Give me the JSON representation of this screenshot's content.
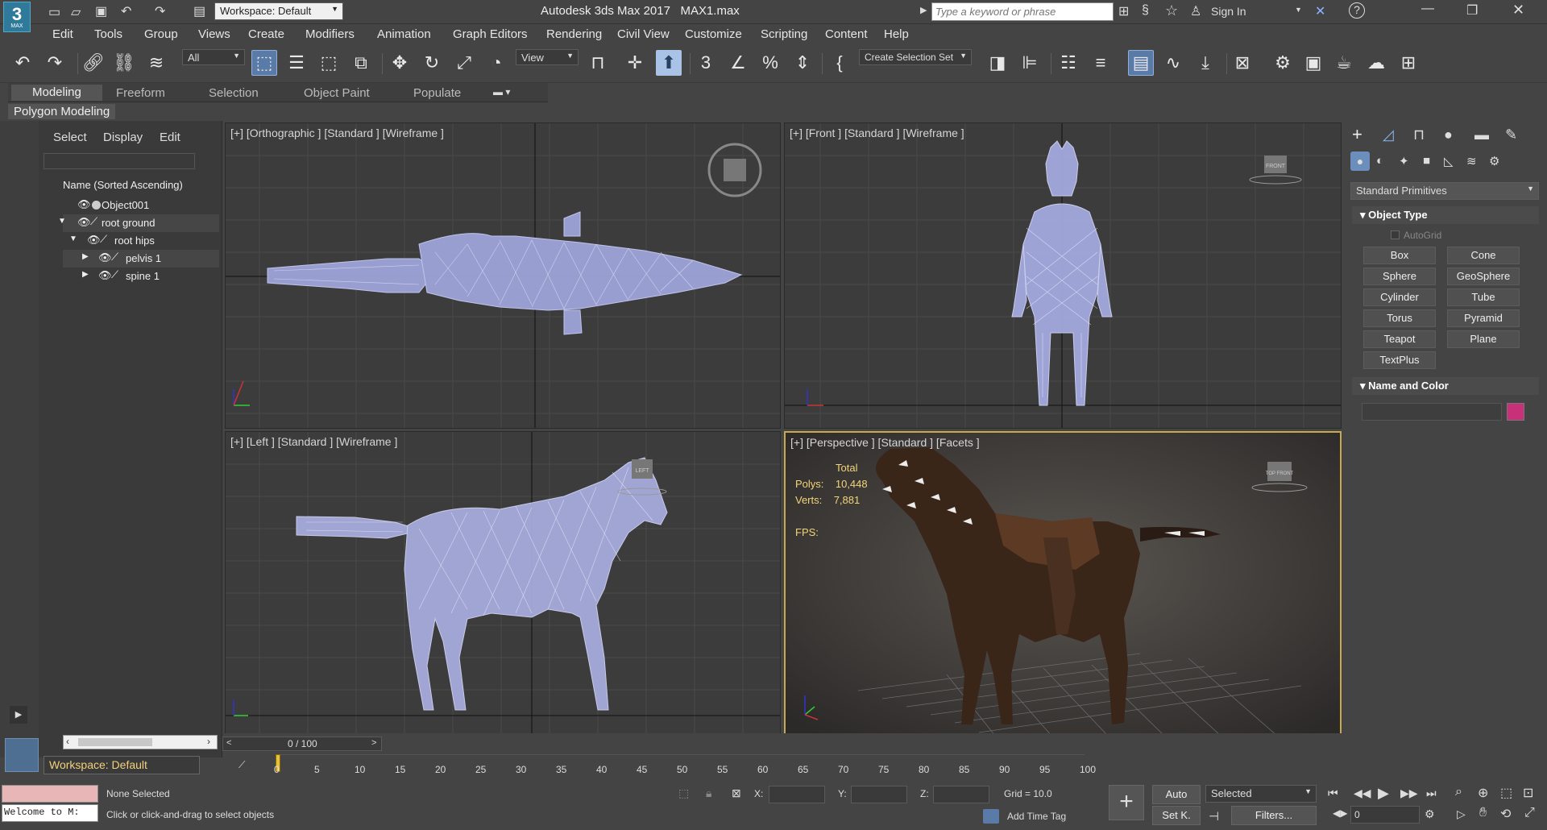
{
  "titlebar": {
    "workspace_label": "Workspace: Default",
    "title": "Autodesk 3ds Max 2017",
    "file": "MAX1.max",
    "search_placeholder": "Type a keyword or phrase",
    "sign_in": "Sign In",
    "logo_text": "MAX"
  },
  "menu": [
    "Edit",
    "Tools",
    "Group",
    "Views",
    "Create",
    "Modifiers",
    "Animation",
    "Graph Editors",
    "Rendering",
    "Civil View",
    "Customize",
    "Scripting",
    "Content",
    "Help"
  ],
  "toolbar": {
    "filter_value": "All",
    "refcoord_value": "View",
    "selection_set": "Create Selection Set"
  },
  "ribbon": {
    "tabs": [
      "Modeling",
      "Freeform",
      "Selection",
      "Object Paint",
      "Populate"
    ],
    "panel_label": "Polygon Modeling"
  },
  "scene_explorer": {
    "tabs": [
      "Select",
      "Display",
      "Edit"
    ],
    "column_header": "Name (Sorted Ascending)",
    "items": [
      "Object001",
      "root ground",
      "root hips",
      "pelvis 1",
      "spine 1"
    ],
    "workspace": "Workspace: Default"
  },
  "viewports": {
    "top_left": "[+] [Orthographic ] [Standard ] [Wireframe ]",
    "top_right": "[+] [Front ] [Standard ] [Wireframe ]",
    "bottom_left": "[+] [Left ] [Standard ] [Wireframe ]",
    "bottom_right": "[+] [Perspective ] [Standard ] [Facets ]",
    "stats": {
      "total_label": "Total",
      "polys_label": "Polys:",
      "polys_value": "10,448",
      "verts_label": "Verts:",
      "verts_value": "7,881",
      "fps_label": "FPS:"
    },
    "cube_labels": {
      "front": "FRONT",
      "left": "LEFT",
      "persp": "TOP FRONT"
    }
  },
  "command_panel": {
    "category": "Standard Primitives",
    "object_type_title": "Object Type",
    "autogrid": "AutoGrid",
    "primitives": [
      "Box",
      "Cone",
      "Sphere",
      "GeoSphere",
      "Cylinder",
      "Tube",
      "Torus",
      "Pyramid",
      "Teapot",
      "Plane",
      "TextPlus"
    ],
    "name_color_title": "Name and Color",
    "object_color": "#c8307a"
  },
  "timeline": {
    "frame_counter": "0 / 100",
    "ticks": [
      "0",
      "5",
      "10",
      "15",
      "20",
      "25",
      "30",
      "35",
      "40",
      "45",
      "50",
      "55",
      "60",
      "65",
      "70",
      "75",
      "80",
      "85",
      "90",
      "95",
      "100"
    ]
  },
  "status": {
    "maxscript": "Welcome to M:",
    "selection": "None Selected",
    "prompt": "Click or click-and-drag to select objects",
    "x_label": "X:",
    "y_label": "Y:",
    "z_label": "Z:",
    "grid": "Grid = 10.0",
    "add_time_tag": "Add Time Tag",
    "auto": "Auto",
    "selected": "Selected",
    "setk": "Set K.",
    "filters": "Filters...",
    "frame": "0"
  },
  "colors": {
    "accent": "#5a7aa8",
    "active_viewport": "#c9a950",
    "wireframe": "#b8bcf0"
  }
}
